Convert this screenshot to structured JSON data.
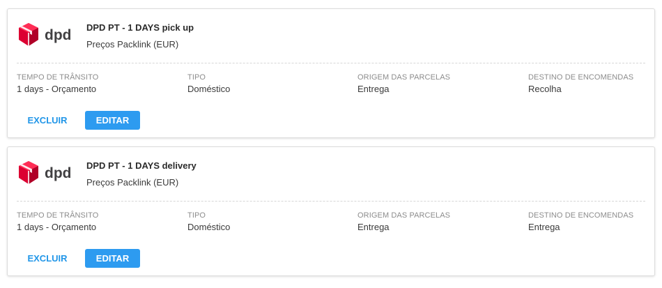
{
  "brand": {
    "logo_text": "dpd",
    "accent_color": "#dc0032",
    "button_color": "#2d9bf0",
    "link_color": "#2196e8"
  },
  "services": [
    {
      "title": "DPD PT - 1 DAYS pick up",
      "pricing": "Preços Packlink (EUR)",
      "fields": [
        {
          "label": "TEMPO DE TRÂNSITO",
          "value": "1 days - Orçamento"
        },
        {
          "label": "TIPO",
          "value": "Doméstico"
        },
        {
          "label": "ORIGEM DAS PARCELAS",
          "value": "Entrega"
        },
        {
          "label": "DESTINO DE ENCOMENDAS",
          "value": "Recolha"
        }
      ],
      "delete_label": "EXCLUIR",
      "edit_label": "EDITAR"
    },
    {
      "title": "DPD PT - 1 DAYS delivery",
      "pricing": "Preços Packlink (EUR)",
      "fields": [
        {
          "label": "TEMPO DE TRÂNSITO",
          "value": "1 days - Orçamento"
        },
        {
          "label": "TIPO",
          "value": "Doméstico"
        },
        {
          "label": "ORIGEM DAS PARCELAS",
          "value": "Entrega"
        },
        {
          "label": "DESTINO DE ENCOMENDAS",
          "value": "Entrega"
        }
      ],
      "delete_label": "EXCLUIR",
      "edit_label": "EDITAR"
    }
  ]
}
